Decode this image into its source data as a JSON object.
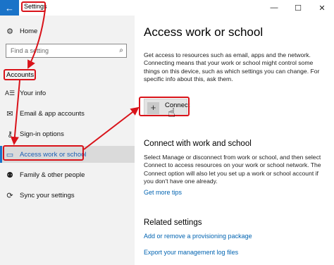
{
  "window": {
    "title": "Settings",
    "back_icon": "back-arrow-icon",
    "controls": {
      "minimize": "—",
      "maximize": "☐",
      "close": "✕"
    }
  },
  "sidebar": {
    "home_label": "Home",
    "search_placeholder": "Find a setting",
    "section_label": "Accounts",
    "items": [
      {
        "label": "Your info",
        "icon": "person-card-icon",
        "glyph": "A☰"
      },
      {
        "label": "Email & app accounts",
        "icon": "envelope-icon",
        "glyph": "✉"
      },
      {
        "label": "Sign-in options",
        "icon": "key-icon",
        "glyph": "⚷"
      },
      {
        "label": "Access work or school",
        "icon": "briefcase-icon",
        "glyph": "▭"
      },
      {
        "label": "Family & other people",
        "icon": "people-icon",
        "glyph": "⚉"
      },
      {
        "label": "Sync your settings",
        "icon": "sync-icon",
        "glyph": "⟳"
      }
    ]
  },
  "main": {
    "title": "Access work or school",
    "description": "Get access to resources such as email, apps and the network. Connecting means that your work or school might control some things on this device, such as which settings you can change. For specific info about this, ask them.",
    "connect_label": "Connect",
    "connect_section_title": "Connect with work and school",
    "connect_section_text": "Select Manage or disconnect from work or school, and then select Connect to access resources on your work or school network. The Connect option will also let you set up a work or school account if you don't have one already.",
    "tips_link": "Get more tips",
    "related_title": "Related settings",
    "related_links": [
      "Add or remove a provisioning package",
      "Export your management log files"
    ]
  },
  "colors": {
    "accent": "#1a73c8",
    "annotation": "#d9131a",
    "link": "#0063b1",
    "sidebar_bg": "#f2f2f2"
  }
}
